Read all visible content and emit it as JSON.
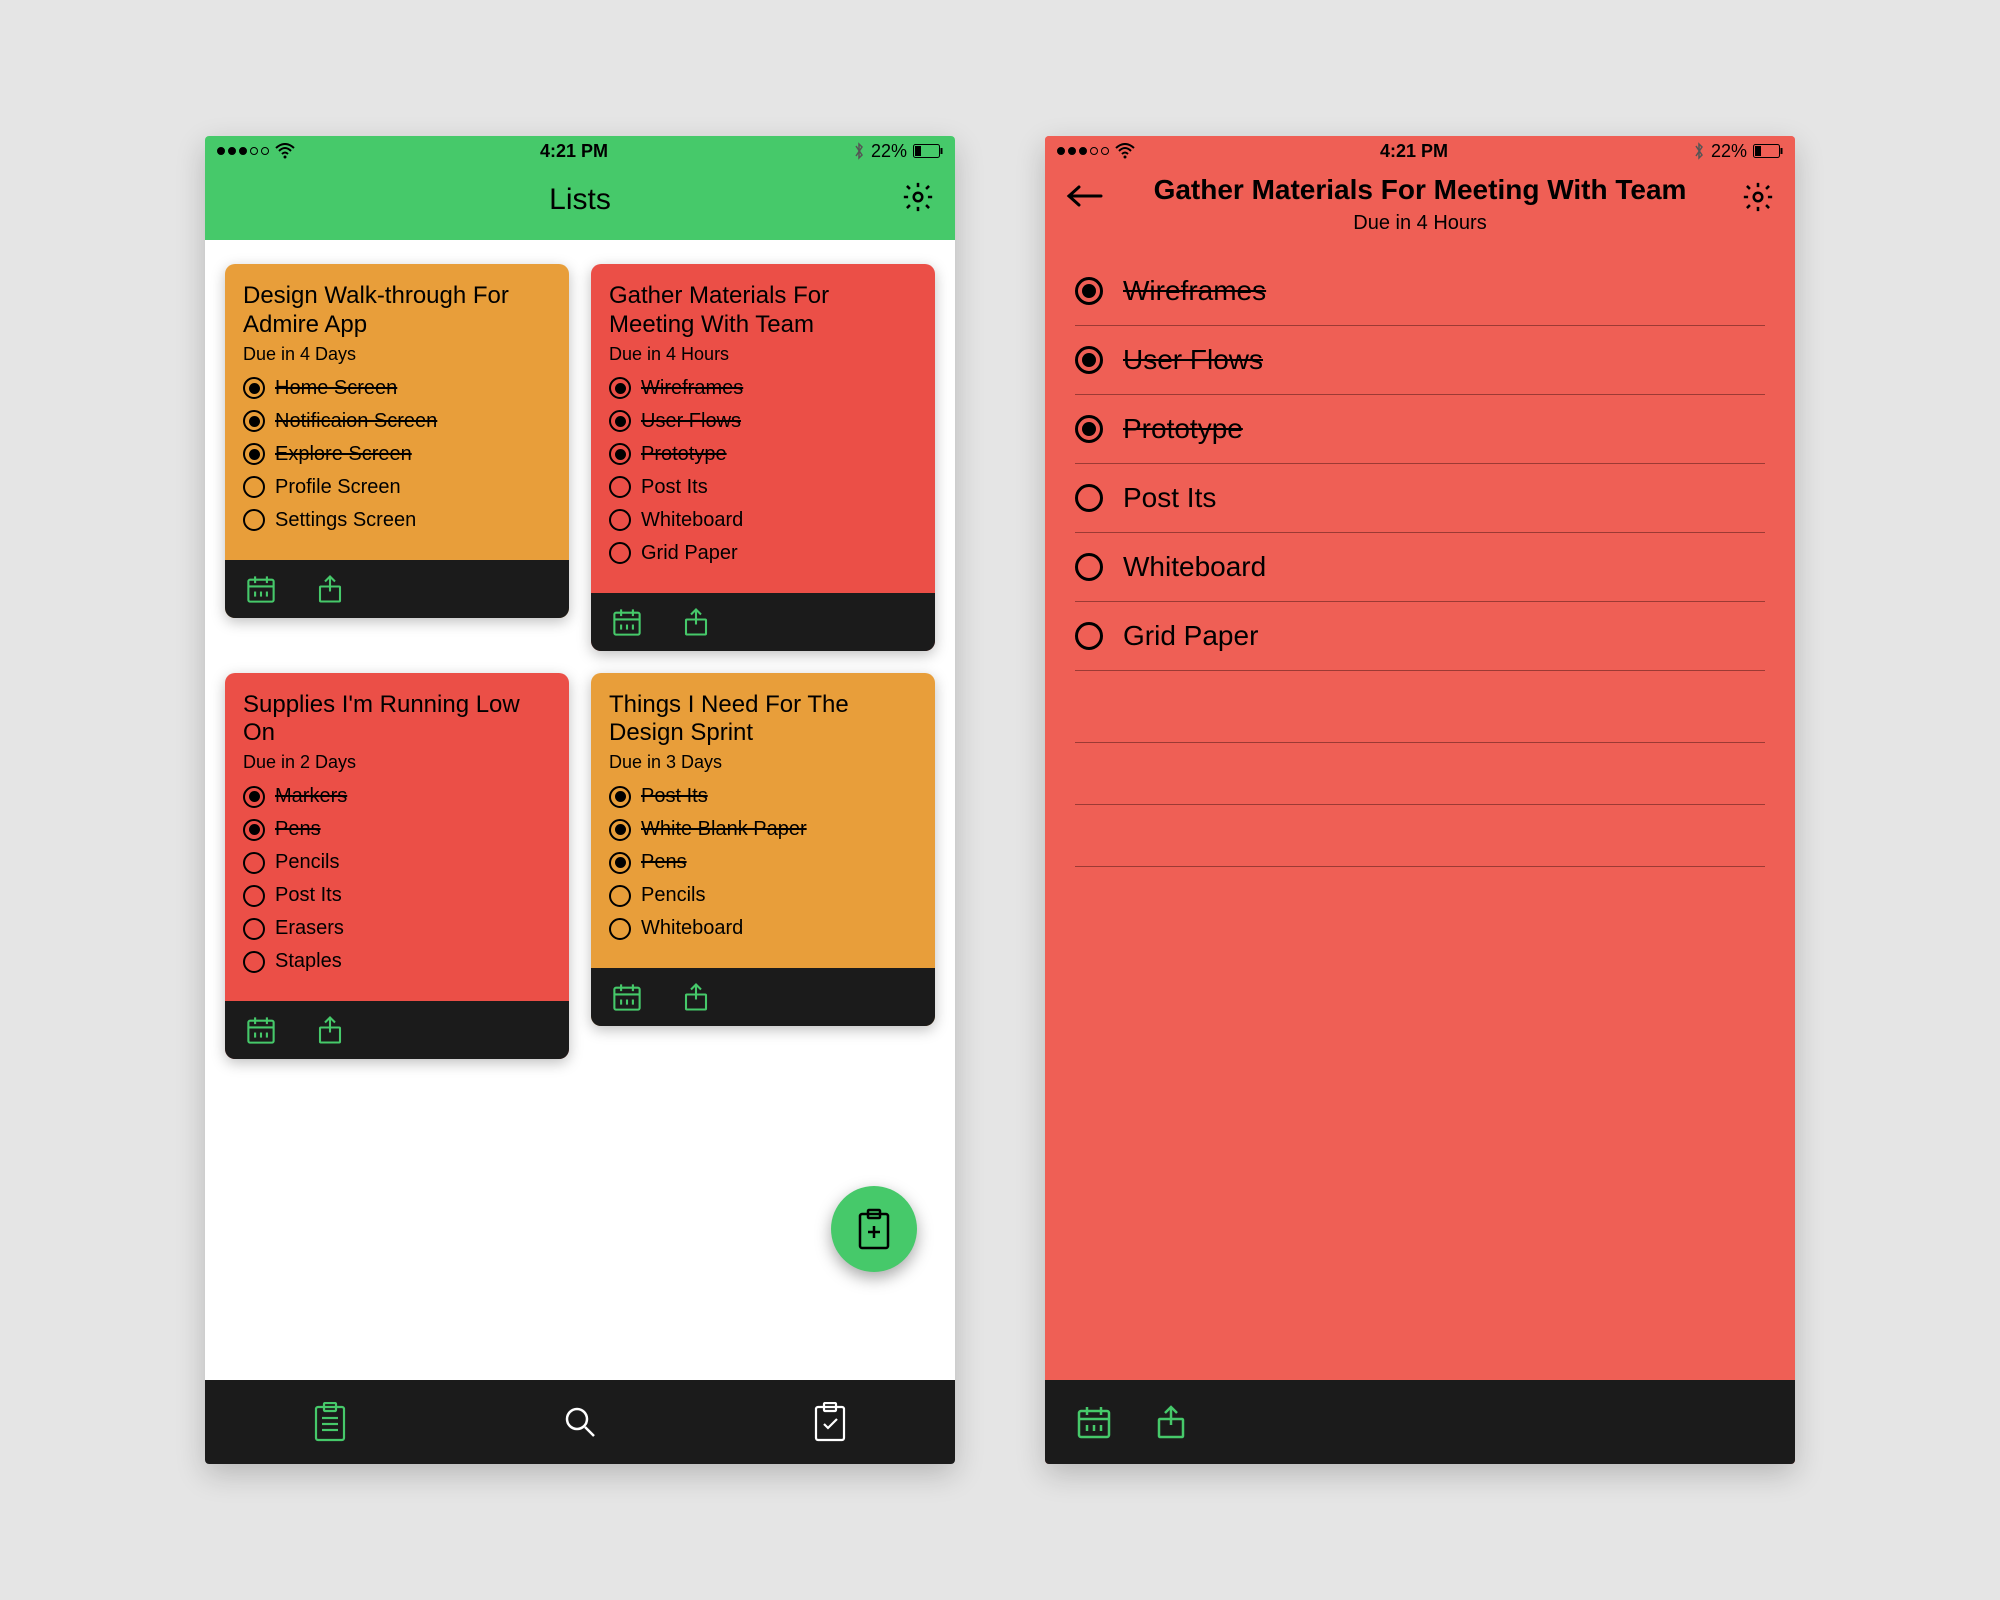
{
  "status": {
    "time": "4:21 PM",
    "battery_text": "22%"
  },
  "colors": {
    "green": "#46C96A",
    "orange": "#E89E3A",
    "red": "#EF5F55",
    "red_dark": "#EB4F47",
    "black": "#1b1b1b"
  },
  "screens": {
    "lists": {
      "title": "Lists",
      "cards": [
        {
          "title": "Design Walk-through For Admire App",
          "due": "Due in 4 Days",
          "color": "orange",
          "items": [
            {
              "label": "Home Screen",
              "done": true
            },
            {
              "label": "Notificaion Screen",
              "done": true
            },
            {
              "label": "Explore Screen",
              "done": true
            },
            {
              "label": "Profile Screen",
              "done": false
            },
            {
              "label": "Settings Screen",
              "done": false
            }
          ]
        },
        {
          "title": "Gather Materials For Meeting With Team",
          "due": "Due in 4 Hours",
          "color": "red",
          "items": [
            {
              "label": "Wireframes",
              "done": true
            },
            {
              "label": "User Flows",
              "done": true
            },
            {
              "label": "Prototype",
              "done": true
            },
            {
              "label": "Post Its",
              "done": false
            },
            {
              "label": "Whiteboard",
              "done": false
            },
            {
              "label": "Grid Paper",
              "done": false
            }
          ]
        },
        {
          "title": "Supplies I'm Running Low On",
          "due": "Due in 2 Days",
          "color": "red",
          "items": [
            {
              "label": "Markers",
              "done": true
            },
            {
              "label": "Pens",
              "done": true
            },
            {
              "label": "Pencils",
              "done": false
            },
            {
              "label": "Post Its",
              "done": false
            },
            {
              "label": "Erasers",
              "done": false
            },
            {
              "label": "Staples",
              "done": false
            }
          ]
        },
        {
          "title": "Things I Need For The Design Sprint",
          "due": "Due in 3 Days",
          "color": "orange",
          "items": [
            {
              "label": "Post Its",
              "done": true
            },
            {
              "label": "White Blank Paper",
              "done": true
            },
            {
              "label": "Pens",
              "done": true
            },
            {
              "label": "Pencils",
              "done": false
            },
            {
              "label": "Whiteboard",
              "done": false
            }
          ]
        }
      ]
    },
    "detail": {
      "title": "Gather Materials For Meeting With Team",
      "due": "Due in 4 Hours",
      "items": [
        {
          "label": "Wireframes",
          "done": true
        },
        {
          "label": "User Flows",
          "done": true
        },
        {
          "label": "Prototype",
          "done": true
        },
        {
          "label": "Post Its",
          "done": false
        },
        {
          "label": "Whiteboard",
          "done": false
        },
        {
          "label": "Grid Paper",
          "done": false
        }
      ]
    }
  }
}
